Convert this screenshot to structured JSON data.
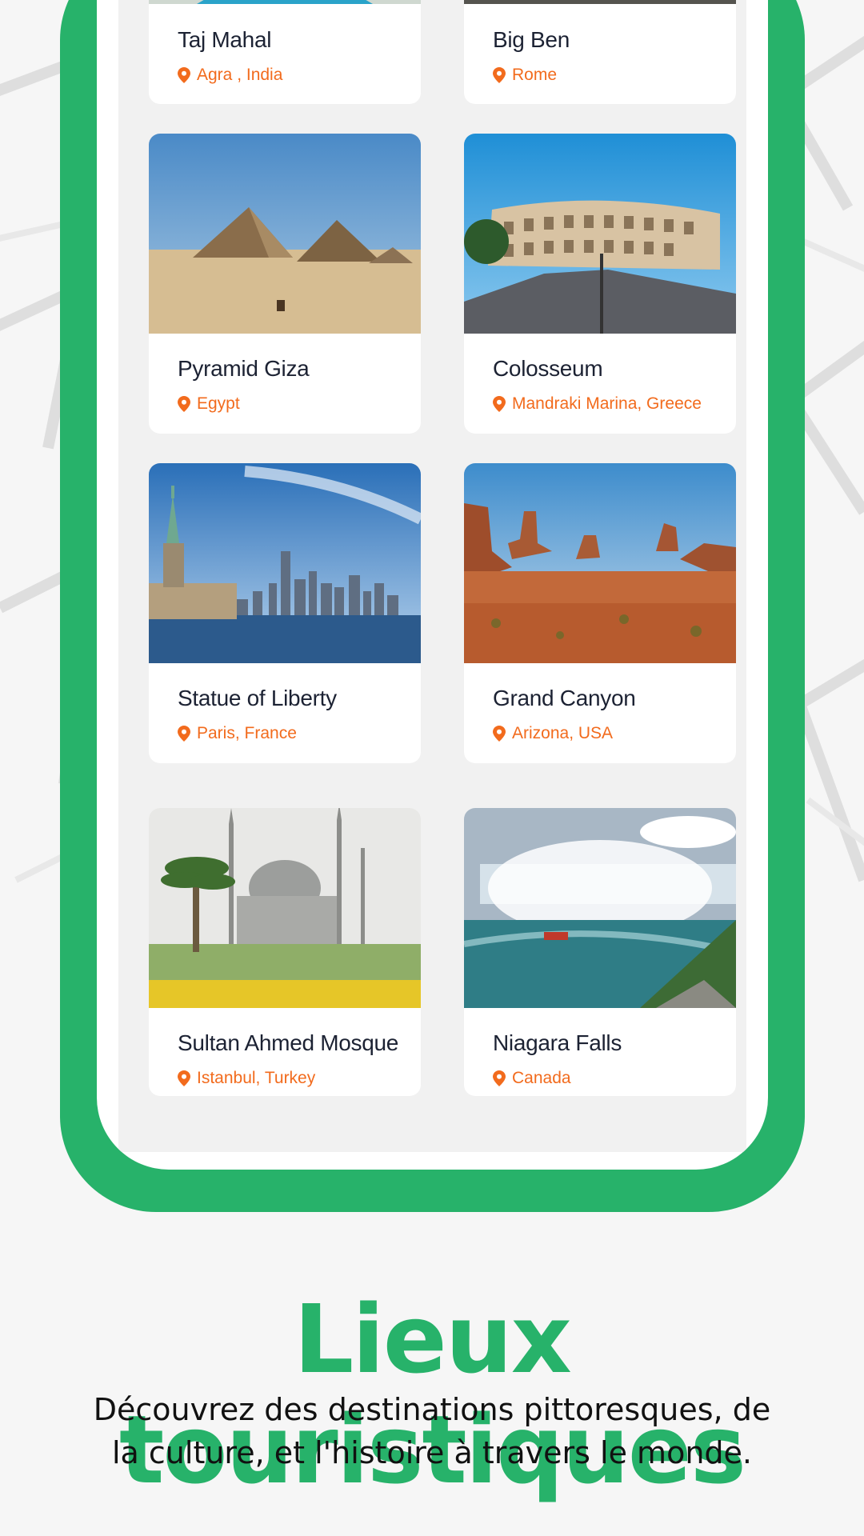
{
  "places": [
    {
      "name": "Taj Mahal",
      "location": "Agra , India"
    },
    {
      "name": "Big Ben",
      "location": "Rome"
    },
    {
      "name": "Pyramid Giza",
      "location": "Egypt"
    },
    {
      "name": "Colosseum",
      "location": "Mandraki Marina, Greece"
    },
    {
      "name": "Statue of Liberty",
      "location": "Paris, France"
    },
    {
      "name": "Grand Canyon",
      "location": "Arizona, USA"
    },
    {
      "name": "Sultan Ahmed Mosque",
      "location": "Istanbul, Turkey"
    },
    {
      "name": "Niagara Falls",
      "location": "Canada"
    }
  ],
  "promo": {
    "headline": "Lieux touristiques",
    "subtitle_line1": "Découvrez des destinations pittoresques, de",
    "subtitle_line2": "la culture, et l'histoire à travers le monde."
  },
  "colors": {
    "brand_green": "#27b26a",
    "location_orange": "#f26b1d",
    "title_dark": "#1c2233"
  }
}
